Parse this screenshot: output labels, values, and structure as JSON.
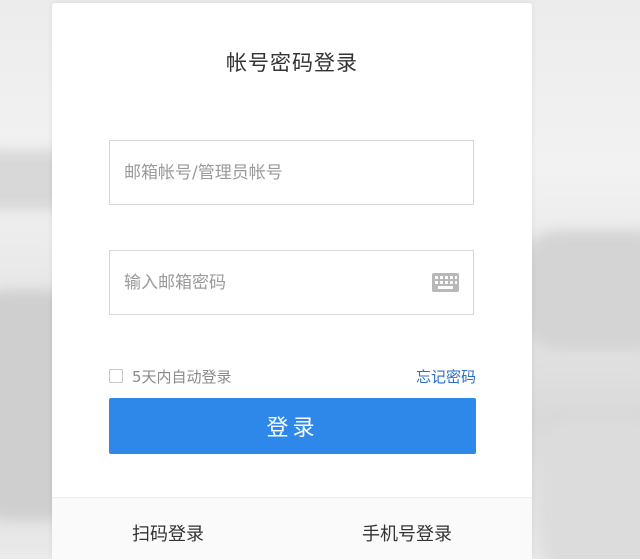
{
  "login": {
    "title": "帐号密码登录",
    "account_placeholder": "邮箱帐号/管理员帐号",
    "password_placeholder": "输入邮箱密码",
    "remember_label": "5天内自动登录",
    "remember_checked": false,
    "forgot_label": "忘记密码",
    "submit_label": "登录"
  },
  "footer": {
    "qr_login_label": "扫码登录",
    "phone_login_label": "手机号登录"
  },
  "icons": {
    "keyboard": "keyboard-icon"
  },
  "colors": {
    "primary_button": "#2e88ea",
    "link": "#2b6fc6"
  }
}
